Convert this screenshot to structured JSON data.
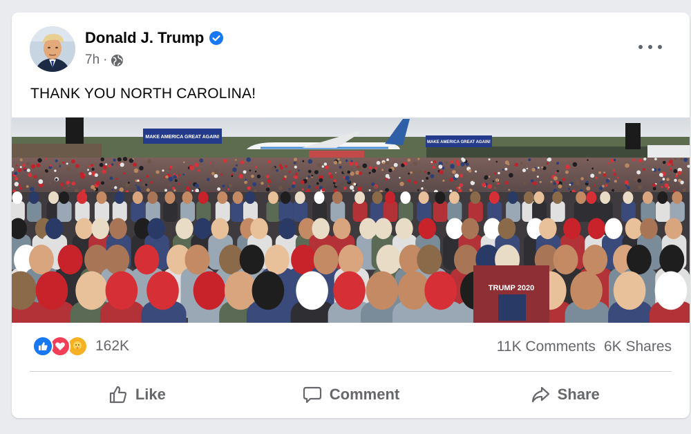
{
  "post": {
    "author": "Donald J. Trump",
    "time": "7h",
    "separator": "·",
    "text": "THANK YOU NORTH CAROLINA!",
    "photo": {
      "banner_left": "MAKE AMERICA GREAT AGAIN!",
      "banner_right": "MAKE AMERICA GREAT AGAIN!",
      "shirt_text": "TRUMP 2020"
    }
  },
  "reactions": {
    "icons": [
      "like-icon",
      "love-icon",
      "care-icon"
    ],
    "count": "162K"
  },
  "stats": {
    "comments": "11K Comments",
    "shares": "6K Shares"
  },
  "actions": {
    "like": "Like",
    "comment": "Comment",
    "share": "Share"
  },
  "colors": {
    "verified": "#1877f2",
    "like": "#1877f2",
    "love": "#f33e58",
    "care": "#f7b125",
    "text_secondary": "#65676b"
  }
}
